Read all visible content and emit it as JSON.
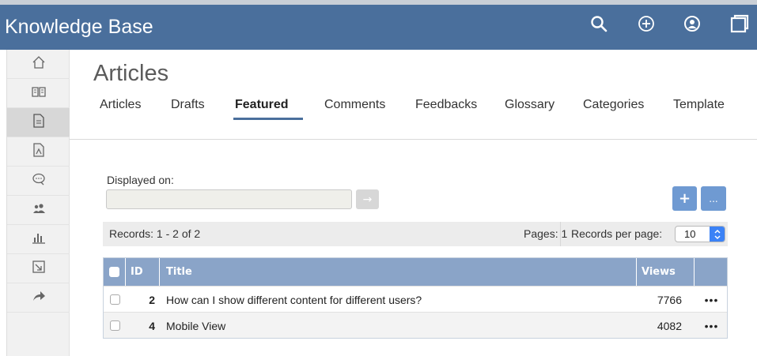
{
  "header": {
    "title": "Knowledge Base",
    "icons": [
      "search-icon",
      "add-circle-icon",
      "user-icon",
      "window-icon"
    ]
  },
  "sidebar": {
    "items": [
      {
        "icon": "home-icon",
        "active": false
      },
      {
        "icon": "book-icon",
        "active": false
      },
      {
        "icon": "document-icon",
        "active": true
      },
      {
        "icon": "pdf-icon",
        "active": false
      },
      {
        "icon": "comments-icon",
        "active": false
      },
      {
        "icon": "users-icon",
        "active": false
      },
      {
        "icon": "bar-chart-icon",
        "active": false
      },
      {
        "icon": "export-icon",
        "active": false
      },
      {
        "icon": "share-arrow-icon",
        "active": false
      }
    ]
  },
  "page": {
    "title": "Articles",
    "tabs": [
      {
        "label": "Articles",
        "active": false
      },
      {
        "label": "Drafts",
        "active": false
      },
      {
        "label": "Featured",
        "active": true
      },
      {
        "label": "Comments",
        "active": false
      },
      {
        "label": "Feedbacks",
        "active": false
      },
      {
        "label": "Glossary",
        "active": false
      },
      {
        "label": "Categories",
        "active": false
      },
      {
        "label": "Template",
        "active": false
      }
    ]
  },
  "filter": {
    "label": "Displayed on:",
    "value": "",
    "go_icon": "→",
    "add_label": "+",
    "more_label": "..."
  },
  "records": {
    "text": "Records: 1 - 2 of 2",
    "pages": "Pages: 1",
    "per_page_label": "Records per page:",
    "per_page_value": "10"
  },
  "table": {
    "columns": [
      "ID",
      "Title",
      "Views"
    ],
    "rows": [
      {
        "id": "2",
        "title": "How can I show different content for different users?",
        "views": "7766",
        "menu": "•••"
      },
      {
        "id": "4",
        "title": "Mobile View",
        "views": "4082",
        "menu": "•••"
      }
    ]
  },
  "colors": {
    "header_bg": "#4a6f9c",
    "table_header_bg": "#8aa4c8",
    "action_button_bg": "#6f9ad2"
  }
}
